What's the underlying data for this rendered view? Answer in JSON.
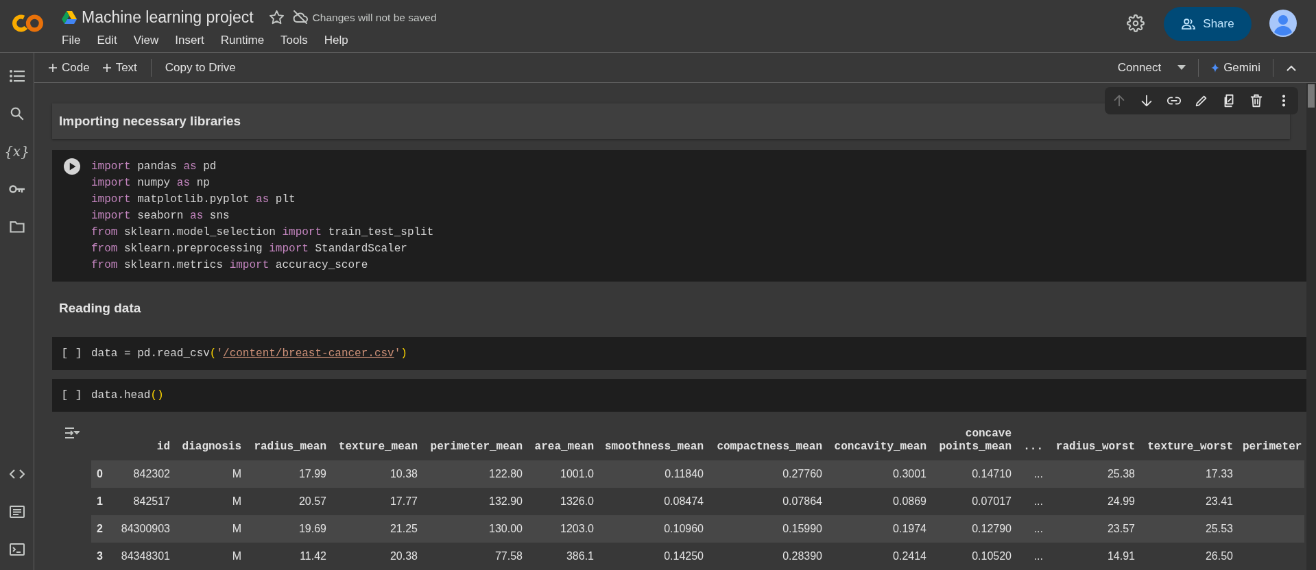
{
  "header": {
    "title": "Machine learning project",
    "save_status": "Changes will not be saved",
    "menu": [
      "File",
      "Edit",
      "View",
      "Insert",
      "Runtime",
      "Tools",
      "Help"
    ],
    "share_label": "Share"
  },
  "toolbar": {
    "add_code": "Code",
    "add_text": "Text",
    "copy": "Copy to Drive",
    "connect": "Connect",
    "gemini": "Gemini"
  },
  "sidebar": {
    "variables_label": "{x}"
  },
  "cell_toolbar": [
    {
      "kind": "up",
      "disabled": true
    },
    {
      "kind": "down",
      "disabled": false
    },
    {
      "kind": "link",
      "disabled": false
    },
    {
      "kind": "edit",
      "disabled": false
    },
    {
      "kind": "mirror",
      "disabled": false
    },
    {
      "kind": "delete",
      "disabled": false
    },
    {
      "kind": "more",
      "disabled": false
    }
  ],
  "cells": [
    {
      "kind": "markdown",
      "selected": true,
      "text": "Importing necessary libraries"
    },
    {
      "kind": "code",
      "selected": false,
      "run_icon": true,
      "lines": [
        [
          {
            "kind": "keyword",
            "text": "import"
          },
          {
            "kind": "plain",
            "text": " pandas "
          },
          {
            "kind": "keyword",
            "text": "as"
          },
          {
            "kind": "plain",
            "text": " pd"
          }
        ],
        [
          {
            "kind": "keyword",
            "text": "import"
          },
          {
            "kind": "plain",
            "text": " numpy "
          },
          {
            "kind": "keyword",
            "text": "as"
          },
          {
            "kind": "plain",
            "text": " np"
          }
        ],
        [
          {
            "kind": "keyword",
            "text": "import"
          },
          {
            "kind": "plain",
            "text": " matplotlib.pyplot "
          },
          {
            "kind": "keyword",
            "text": "as"
          },
          {
            "kind": "plain",
            "text": " plt"
          }
        ],
        [
          {
            "kind": "keyword",
            "text": "import"
          },
          {
            "kind": "plain",
            "text": " seaborn "
          },
          {
            "kind": "keyword",
            "text": "as"
          },
          {
            "kind": "plain",
            "text": " sns"
          }
        ],
        [
          {
            "kind": "keyword",
            "text": "from"
          },
          {
            "kind": "plain",
            "text": " sklearn.model_selection "
          },
          {
            "kind": "keyword",
            "text": "import"
          },
          {
            "kind": "plain",
            "text": " train_test_split"
          }
        ],
        [
          {
            "kind": "keyword",
            "text": "from"
          },
          {
            "kind": "plain",
            "text": " sklearn.preprocessing "
          },
          {
            "kind": "keyword",
            "text": "import"
          },
          {
            "kind": "plain",
            "text": " StandardScaler"
          }
        ],
        [
          {
            "kind": "keyword",
            "text": "from"
          },
          {
            "kind": "plain",
            "text": " sklearn.metrics "
          },
          {
            "kind": "keyword",
            "text": "import"
          },
          {
            "kind": "plain",
            "text": " accuracy_score"
          }
        ]
      ]
    },
    {
      "kind": "markdown",
      "selected": false,
      "text": "Reading data"
    },
    {
      "kind": "code",
      "selected": false,
      "run_icon": false,
      "prompt": "[ ]",
      "lines": [
        [
          {
            "kind": "plain",
            "text": "data = pd.read_csv"
          },
          {
            "kind": "bracket",
            "text": "("
          },
          {
            "kind": "string",
            "text": "'"
          },
          {
            "kind": "path",
            "text": "/content/breast-cancer.csv"
          },
          {
            "kind": "string",
            "text": "'"
          },
          {
            "kind": "bracket",
            "text": ")"
          }
        ]
      ]
    },
    {
      "kind": "code",
      "selected": false,
      "run_icon": false,
      "prompt": "[ ]",
      "lines": [
        [
          {
            "kind": "plain",
            "text": "data.head"
          },
          {
            "kind": "bracket",
            "text": "()"
          }
        ]
      ],
      "output": {
        "columns": [
          "id",
          "diagnosis",
          "radius_mean",
          "texture_mean",
          "perimeter_mean",
          "area_mean",
          "smoothness_mean",
          "compactness_mean",
          "concavity_mean",
          "concave points_mean",
          "...",
          "radius_worst",
          "texture_worst",
          "perimeter"
        ],
        "rows": [
          {
            "index": "0",
            "cells": [
              "842302",
              "M",
              "17.99",
              "10.38",
              "122.80",
              "1001.0",
              "0.11840",
              "0.27760",
              "0.3001",
              "0.14710",
              "...",
              "25.38",
              "17.33"
            ]
          },
          {
            "index": "1",
            "cells": [
              "842517",
              "M",
              "20.57",
              "17.77",
              "132.90",
              "1326.0",
              "0.08474",
              "0.07864",
              "0.0869",
              "0.07017",
              "...",
              "24.99",
              "23.41"
            ]
          },
          {
            "index": "2",
            "cells": [
              "84300903",
              "M",
              "19.69",
              "21.25",
              "130.00",
              "1203.0",
              "0.10960",
              "0.15990",
              "0.1974",
              "0.12790",
              "...",
              "23.57",
              "25.53"
            ]
          },
          {
            "index": "3",
            "cells": [
              "84348301",
              "M",
              "11.42",
              "20.38",
              "77.58",
              "386.1",
              "0.14250",
              "0.28390",
              "0.2414",
              "0.10520",
              "...",
              "14.91",
              "26.50"
            ]
          }
        ]
      }
    }
  ]
}
